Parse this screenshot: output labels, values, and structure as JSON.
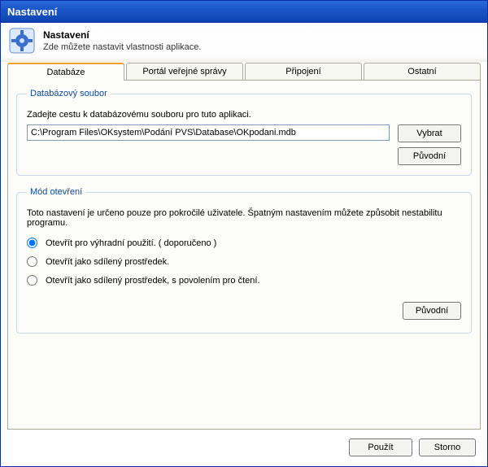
{
  "window": {
    "title": "Nastavení"
  },
  "header": {
    "title": "Nastavení",
    "subtitle": "Zde můžete nastavit vlastnosti aplikace.",
    "icon_name": "settings-icon"
  },
  "tabs": {
    "active_index": 0,
    "items": [
      {
        "label": "Databáze"
      },
      {
        "label": "Portál veřejné správy"
      },
      {
        "label": "Připojení"
      },
      {
        "label": "Ostatní"
      }
    ]
  },
  "db_group": {
    "legend": "Databázový soubor",
    "prompt": "Zadejte cestu k databázovému souboru pro tuto aplikaci.",
    "path": "C:\\Program Files\\OKsystem\\Podání PVS\\Database\\OKpodani.mdb",
    "browse_label": "Vybrat",
    "default_label": "Původní"
  },
  "mode_group": {
    "legend": "Mód otevření",
    "note": "Toto nastavení je určeno pouze pro pokročilé uživatele. Špatným nastavením můžete způsobit nestabilitu programu.",
    "options": [
      "Otevřít pro výhradní použití. ( doporučeno )",
      "Otevřít jako sdílený prostředek.",
      "Otevřít jako sdílený prostředek, s povolením pro čtení."
    ],
    "selected_index": 0,
    "default_label": "Původní"
  },
  "footer": {
    "apply_label": "Použít",
    "cancel_label": "Storno"
  }
}
